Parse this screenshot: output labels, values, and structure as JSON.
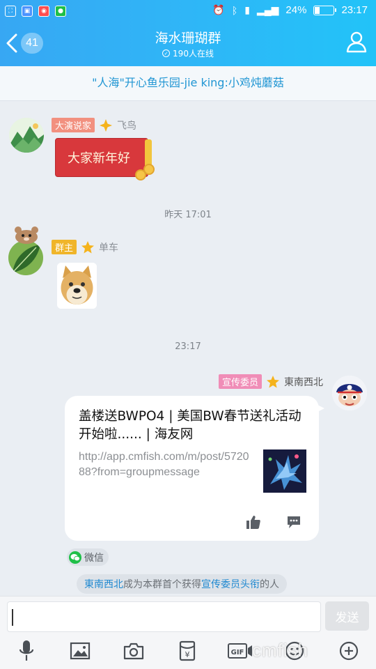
{
  "status_bar": {
    "battery_percent": "24%",
    "battery_level": 0.24,
    "time": "23:17"
  },
  "header": {
    "unread_count": "41",
    "title": "海水珊瑚群",
    "online": "190人在线"
  },
  "notice": {
    "text": "\"人海\"开心鱼乐园-jie king:小鸡炖蘑菇"
  },
  "messages": [
    {
      "tag": "大演说家",
      "sender": "飞鸟",
      "red_packet_text": "大家新年好"
    },
    {
      "tag": "群主",
      "sender": "单车"
    },
    {
      "tag": "宣传委员",
      "sender": "東南西北",
      "link_title": "盖楼送BWPO4 | 美国BW春节送礼活动开始啦...... | 海友网",
      "link_url": "http://app.cmfish.com/m/post/572088?from=groupmessage",
      "source": "微信"
    }
  ],
  "timestamps": [
    "昨天 17:01",
    "23:17"
  ],
  "system_notice": {
    "name": "東南西北",
    "mid": "成为本群首个获得",
    "title": "宣传委员头衔",
    "end": "的人"
  },
  "input": {
    "send_label": "发送"
  },
  "watermark": "cmfish",
  "colors": {
    "header": "#2fb6f7",
    "accent": "#1e88d0",
    "red_packet": "#d8383c"
  }
}
